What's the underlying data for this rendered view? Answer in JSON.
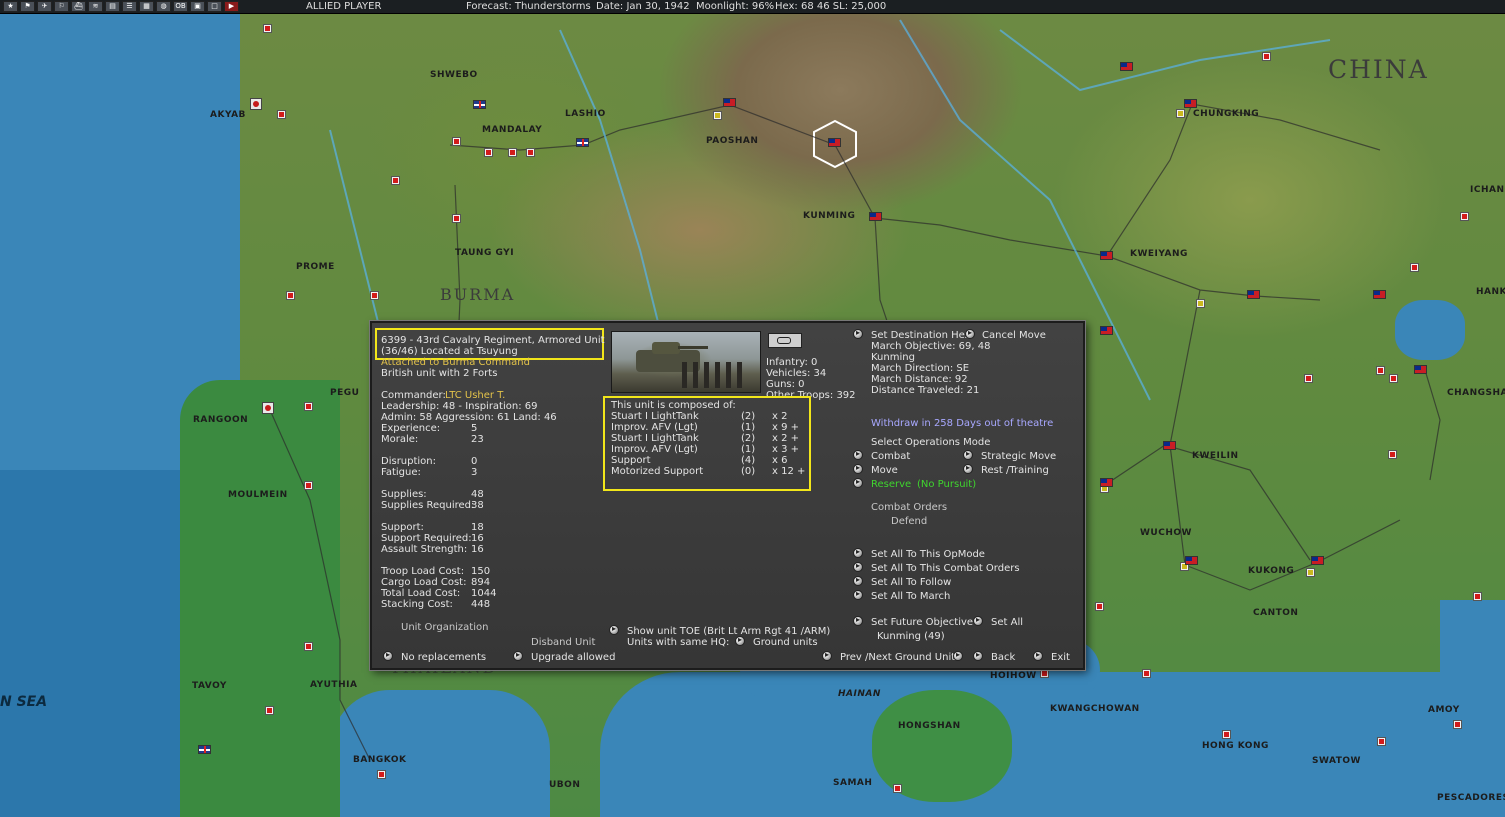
{
  "topbar": {
    "icons": [
      "star-icon",
      "flag-icon",
      "plane-icon",
      "flag-icon",
      "ship-icon",
      "ship-icon",
      "book-icon",
      "list-icon",
      "calendar-icon",
      "globe-icon",
      "ob-icon",
      "box-icon",
      "window-icon",
      "play-icon"
    ],
    "icon_ob_label": "OB",
    "player": "ALLIED PLAYER",
    "forecast": "Forecast: Thunderstorms",
    "date": "Date: Jan 30, 1942",
    "moonlight": "Moonlight: 96%",
    "hex": "Hex: 68  46   SL: 25,000"
  },
  "map": {
    "region_labels": [
      "CHINA",
      "BURMA",
      "THAILAND"
    ],
    "sea_labels": [
      "N SEA"
    ],
    "island_labels": [
      "HAINAN"
    ],
    "cities": [
      "AKYAB",
      "SHWEBO",
      "MANDALAY",
      "LASHIO",
      "PAOSHAN",
      "KUNMING",
      "CHUNGKING",
      "ICHANG",
      "KWEIYANG",
      "HANK",
      "CHANGSHA",
      "TAUNG GYI",
      "PROME",
      "PEGU",
      "RANGOON",
      "MOULMEIN",
      "KWEILIN",
      "WUCHOW",
      "KUKONG",
      "CANTON",
      "KWANGCHOWAN",
      "AMOY",
      "HONG KONG",
      "SWATOW",
      "PESCADORES",
      "HOIHOW",
      "HONGSHAN",
      "SAMAH",
      "TAVOY",
      "AYUTHIA",
      "BANGKOK",
      "UBON"
    ]
  },
  "dialog": {
    "unit_title_line1": "6399 - 43rd Cavalry Regiment, Armored Unit",
    "unit_title_line2": "(36/46) Located at Tsuyung",
    "attached": "Attached to Burma Command",
    "british": "British unit with 2 Forts",
    "commander_label": "Commander:",
    "commander_name": "LTC Usher T.",
    "leadership": "Leadership: 48 - Inspiration: 69",
    "admin": "  Admin: 58  Aggression: 61  Land: 46",
    "stats": [
      {
        "label": "Experience:",
        "value": "5"
      },
      {
        "label": "Morale:",
        "value": "23"
      },
      {
        "label": "Disruption:",
        "value": "0"
      },
      {
        "label": "Fatigue:",
        "value": "3"
      },
      {
        "label": "Supplies:",
        "value": "48"
      },
      {
        "label": "Supplies Required:",
        "value": "38"
      },
      {
        "label": "Support:",
        "value": "18"
      },
      {
        "label": "Support Required:",
        "value": "16"
      },
      {
        "label": "Assault Strength:",
        "value": "16"
      },
      {
        "label": "Troop Load Cost:",
        "value": "150"
      },
      {
        "label": "Cargo Load Cost:",
        "value": "894"
      },
      {
        "label": "Total Load Cost:",
        "value": "1044"
      },
      {
        "label": "Stacking Cost:",
        "value": "448"
      }
    ],
    "composition": {
      "infantry": "Infantry: 0",
      "vehicles": "Vehicles: 34",
      "guns": "Guns: 0",
      "other": "Other Troops: 392"
    },
    "toe_title": "This unit is composed of:",
    "toe": [
      {
        "name": "Stuart I LightTank",
        "qty": "(2)",
        "mult": "x 2"
      },
      {
        "name": "Improv. AFV (Lgt)",
        "qty": "(1)",
        "mult": "x 9 +"
      },
      {
        "name": "Stuart I LightTank",
        "qty": "(2)",
        "mult": "x 2 +"
      },
      {
        "name": "Improv. AFV (Lgt)",
        "qty": "(1)",
        "mult": "x 3 +"
      },
      {
        "name": "Support",
        "qty": "(4)",
        "mult": "x 6"
      },
      {
        "name": "Motorized Support",
        "qty": "(0)",
        "mult": "x 12 +"
      }
    ],
    "right": {
      "set_destination": "Set Destination Hex",
      "cancel_move": "Cancel Move",
      "march_objective": "March Objective:  69, 48",
      "march_city": "Kunming",
      "march_direction": "March Direction: SE",
      "march_distance": "March Distance:   92",
      "distance_traveled": "Distance Traveled:  21",
      "withdraw": "Withdraw in 258 Days out of theatre",
      "select_ops": "Select Operations Mode",
      "combat": "Combat",
      "strategic": "Strategic Move",
      "move": "Move",
      "rest": "Rest /Training",
      "reserve": "Reserve",
      "no_pursuit": "(No Pursuit)",
      "combat_orders": "Combat Orders",
      "defend": "Defend",
      "set_all_opmode": "Set All To This OpMode",
      "set_all_combat": "Set All To This Combat Orders",
      "set_all_follow": "Set All To Follow",
      "set_all_march": "Set All To March",
      "set_future": "Set Future Objective",
      "set_all": "Set All",
      "future_city": "Kunming (49)"
    },
    "bottom": {
      "unit_org": "Unit Organization",
      "disband": "Disband Unit",
      "no_replacements": "No replacements",
      "upgrade": "Upgrade allowed",
      "show_toe": "Show unit TOE (Brit Lt Arm Rgt 41 /ARM)",
      "units_same_hq": "Units with same HQ:",
      "ground_units": "Ground units",
      "prev_next": "Prev /Next Ground Unit",
      "back": "Back",
      "exit": "Exit"
    }
  },
  "colors": {
    "highlight": "#f2e61a",
    "reserve": "#3fd42e",
    "withdraw": "#a8a8ff",
    "commander": "#e2c24a"
  }
}
